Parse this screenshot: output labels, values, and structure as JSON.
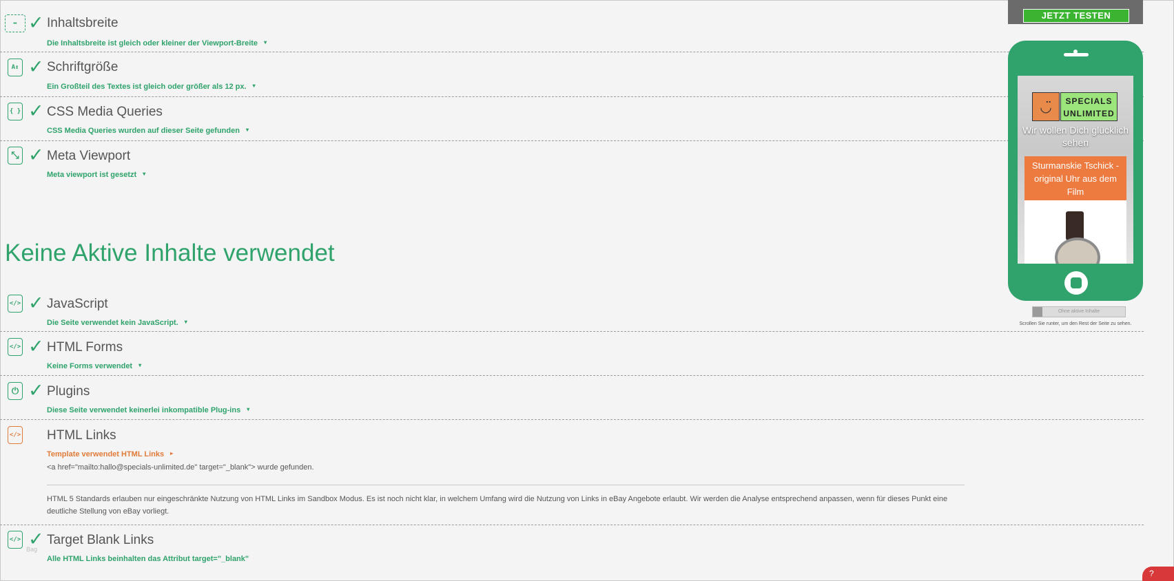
{
  "rows_top": [
    {
      "title": "Inhaltsbreite",
      "sub": "Die Inhaltsbreite ist gleich oder kleiner der Viewport-Breite",
      "icon": "viewport-width-icon",
      "passed": true
    },
    {
      "title": "Schriftgröße",
      "sub": "Ein Großteil des Textes ist gleich oder größer als 12 px.",
      "icon": "font-size-icon",
      "passed": true
    },
    {
      "title": "CSS Media Queries",
      "sub": "CSS Media Queries wurden auf dieser Seite gefunden",
      "icon": "css-braces-icon",
      "passed": true
    },
    {
      "title": "Meta Viewport",
      "sub": "Meta viewport ist gesetzt",
      "icon": "meta-viewport-icon",
      "passed": true
    }
  ],
  "section_heading": "Keine Aktive Inhalte verwendet",
  "rows_bottom": [
    {
      "title": "JavaScript",
      "sub": "Die Seite verwendet kein JavaScript.",
      "icon": "code-tag-icon",
      "passed": true
    },
    {
      "title": "HTML Forms",
      "sub": "Keine Forms verwendet",
      "icon": "code-tag-icon",
      "passed": true
    },
    {
      "title": "Plugins",
      "sub": "Diese Seite verwendet keinerlei inkompatible Plug-ins",
      "icon": "plug-icon",
      "passed": true
    },
    {
      "title": "HTML Links",
      "sub": "Template verwendet HTML Links",
      "icon": "code-tag-icon",
      "passed": false
    },
    {
      "title": "Target Blank Links",
      "sub": "Alle HTML Links beinhalten das Attribut target=\"_blank\"",
      "icon": "code-tag-icon",
      "passed": true
    }
  ],
  "html_links_detail": {
    "found_code": "<a href=\"mailto:hallo@specials-unlimited.de\" target=\"_blank\"> wurde gefunden.",
    "note": "HTML 5 Standards erlauben nur eingeschränkte Nutzung von HTML Links im Sandbox Modus. Es ist noch nicht klar, in welchem Umfang wird die Nutzung von Links in eBay Angebote erlaubt. Wir werden die Analyse entsprechend anpassen, wenn für dieses Punkt eine deutliche Stellung von eBay vorliegt."
  },
  "bag_label": "Bag",
  "icon_glyphs": {
    "code": "</>",
    "font": "A↕",
    "braces": "{ }",
    "viewport": "⤡",
    "plug": "⏻"
  },
  "check_glyph": "✓",
  "caret_glyph": "▾",
  "sidebar": {
    "ad_button": "JETZT TESTEN",
    "phone": {
      "logo_line1": "SPECIALS",
      "logo_line2": "UNLIMITED",
      "tagline": "Wir wollen Dich glücklich sehen",
      "product_title": "Sturmanskie Tschick - original Uhr aus dem Film"
    },
    "toggle_label": "Ohne aktive Inhalte",
    "scroll_hint": "Scrollen Sie runter, um den Rest der Seite zu sehen."
  },
  "help_badge": "?",
  "colors": {
    "accent": "#2fa36b",
    "warning": "#e07b39",
    "background": "#f4f4f4",
    "help": "#d9383a",
    "cta": "#3bb531"
  }
}
